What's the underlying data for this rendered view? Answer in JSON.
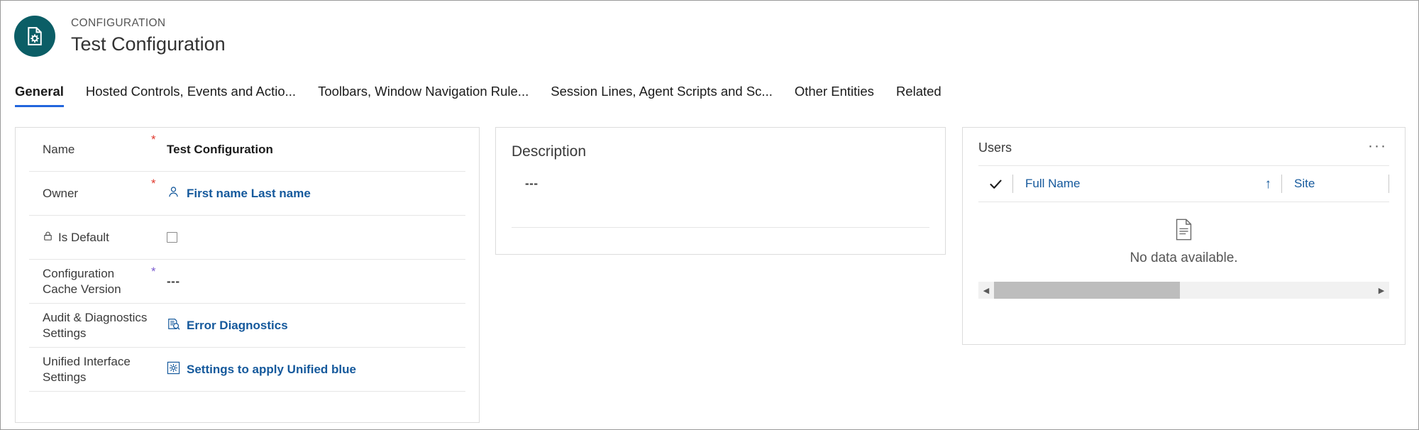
{
  "header": {
    "entity_type": "CONFIGURATION",
    "record_title": "Test Configuration",
    "avatar_icon": "configuration-document-icon",
    "avatar_color": "#0b5e66"
  },
  "tabs": [
    {
      "label": "General",
      "active": true
    },
    {
      "label": "Hosted Controls, Events and Actio...",
      "active": false
    },
    {
      "label": "Toolbars, Window Navigation Rule...",
      "active": false
    },
    {
      "label": "Session Lines, Agent Scripts and Sc...",
      "active": false
    },
    {
      "label": "Other Entities",
      "active": false
    },
    {
      "label": "Related",
      "active": false
    }
  ],
  "accent": {
    "tab_underline": "#2266dd",
    "link": "#15599c",
    "required": "#e03a2f"
  },
  "form": {
    "fields": [
      {
        "label": "Name",
        "required": "*",
        "value": "Test Configuration",
        "type": "text-bold",
        "lock": false,
        "icon": ""
      },
      {
        "label": "Owner",
        "required": "*",
        "value": "First name Last name",
        "type": "link",
        "lock": false,
        "icon": "person-icon"
      },
      {
        "label": "Is Default",
        "required": "",
        "value": "",
        "type": "checkbox",
        "checked": false,
        "lock": true,
        "icon": "lock-icon"
      },
      {
        "label": "Configuration Cache Version",
        "required": "*",
        "value": "---",
        "type": "dashes",
        "lock": false,
        "icon": ""
      },
      {
        "label": "Audit & Diagnostics Settings",
        "required": "",
        "value": "Error Diagnostics",
        "type": "link",
        "lock": false,
        "icon": "error-diagnostics-icon"
      },
      {
        "label": "Unified Interface Settings",
        "required": "",
        "value": "Settings to apply Unified blue",
        "type": "link",
        "lock": false,
        "icon": "unified-settings-gear-icon"
      }
    ]
  },
  "description": {
    "title": "Description",
    "value": "---"
  },
  "users": {
    "title": "Users",
    "overflow_label": "···",
    "columns": [
      {
        "label": "Full Name",
        "sorted": true,
        "sort_direction": "↑"
      },
      {
        "label": "Site",
        "sorted": false,
        "sort_direction": ""
      }
    ],
    "rows": [],
    "empty_text": "No data available.",
    "empty_icon": "document-empty-icon",
    "scrollbar": {
      "left_arrow": "◀",
      "right_arrow": "▶",
      "thumb_percent": 49
    }
  }
}
